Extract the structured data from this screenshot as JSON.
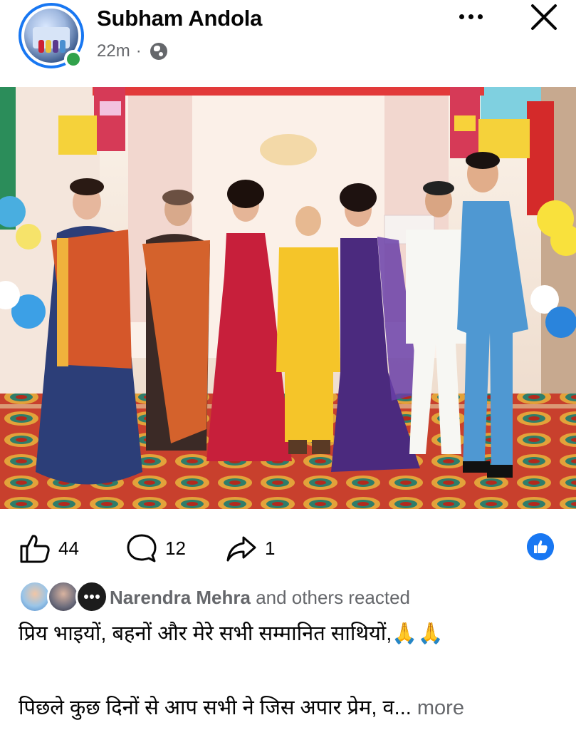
{
  "post": {
    "author": "Subham Andola",
    "time": "22m",
    "separator": "·",
    "privacy_icon": "globe-icon"
  },
  "actions": {
    "likes": "44",
    "comments": "12",
    "shares": "1"
  },
  "reactions": {
    "name": "Narendra Mehra",
    "suffix": "and others reacted"
  },
  "caption": {
    "line1": "प्रिय भाइयों, बहनों और मेरे सभी सम्मानित साथियों,",
    "emoji": "🙏🙏",
    "line2": "पिछले कुछ दिनों से आप सभी ने जिस अपार प्रेम, व...",
    "more": "more"
  },
  "colors": {
    "accent": "#1877f2",
    "online": "#31a24c",
    "secondary_text": "#65676b"
  }
}
